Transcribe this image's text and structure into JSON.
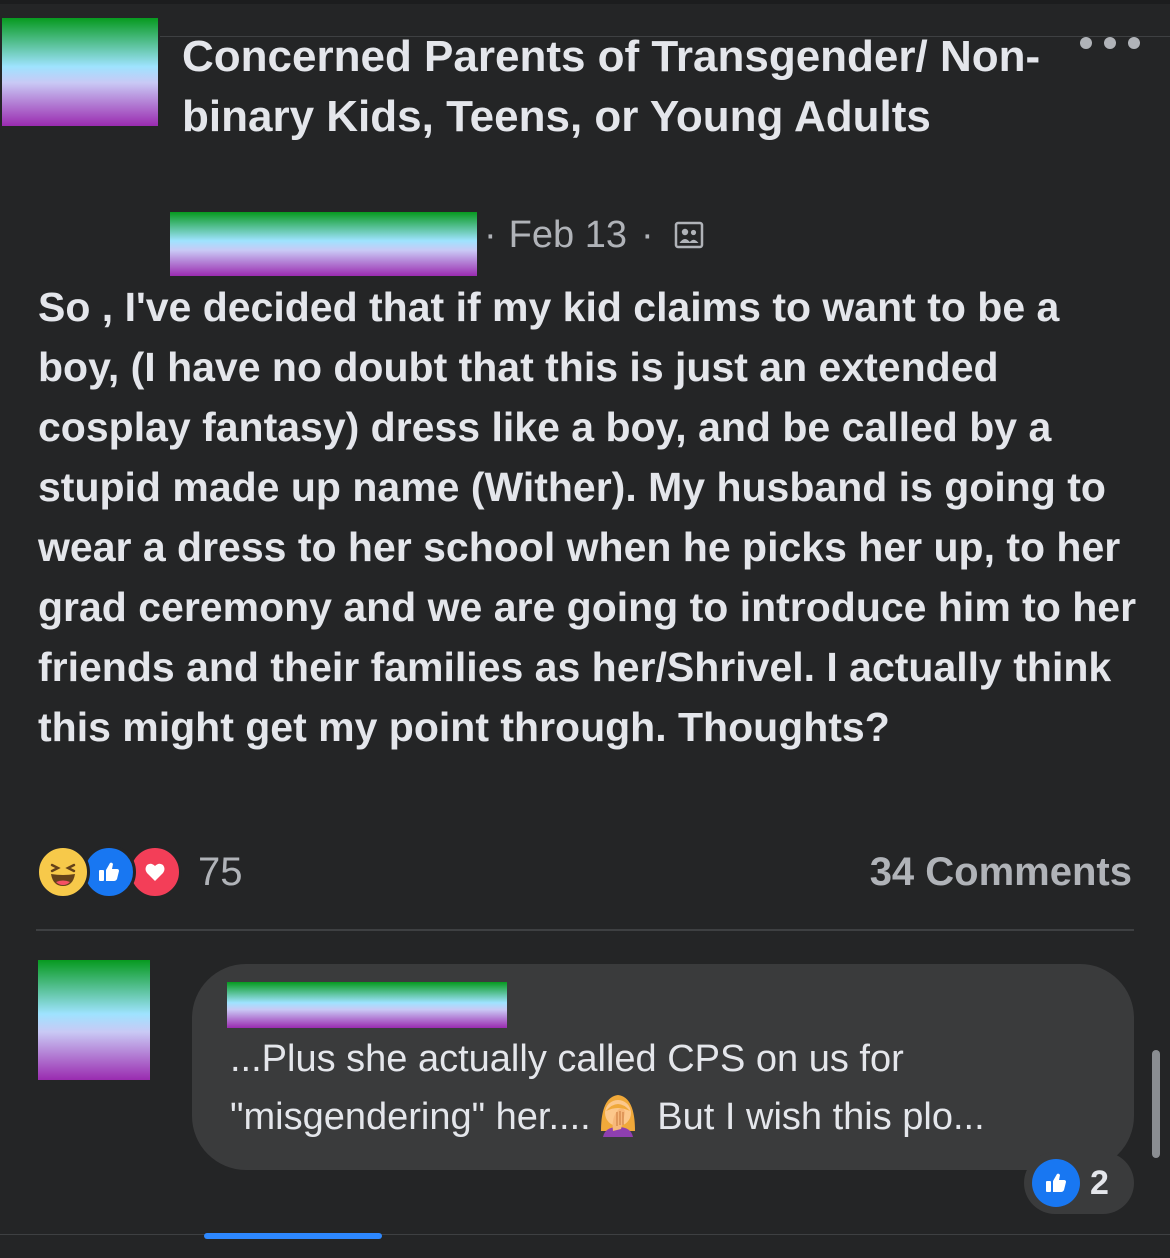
{
  "post": {
    "group_name": "Concerned Parents of Transgender/ Non-binary Kids, Teens, or Young Adults",
    "date": "Feb 13",
    "separator": "·",
    "privacy_icon": "members-group-icon",
    "body": "So , I've decided that if my kid claims to want to be a boy, (I have no doubt that this is just an extended cosplay fantasy) dress like a boy, and be called by a stupid made up name (Wither). My husband is going to wear a dress to her school when he picks her up, to her grad ceremony and we are going to introduce him to her friends and their families as her/Shrivel. I actually think this might get my point through. Thoughts?",
    "reactions": [
      "haha",
      "like",
      "love"
    ],
    "reaction_count": "75",
    "comments_label": "34 Comments"
  },
  "comment": {
    "text_before_emoji": "...Plus she actually called CPS on us for \"misgendering\" her....",
    "emoji": "woman-facepalming",
    "text_after_emoji": " But I wish this plo...",
    "like_count": "2"
  },
  "colors": {
    "background": "#242526",
    "bubble": "#3a3b3c",
    "primary_text": "#e4e6eb",
    "secondary_text": "#b0b3b8",
    "accent": "#1877f2",
    "redaction_top": "#079a1f",
    "redaction_mid": "#9fe3ff",
    "redaction_bottom": "#9a2bb0"
  }
}
